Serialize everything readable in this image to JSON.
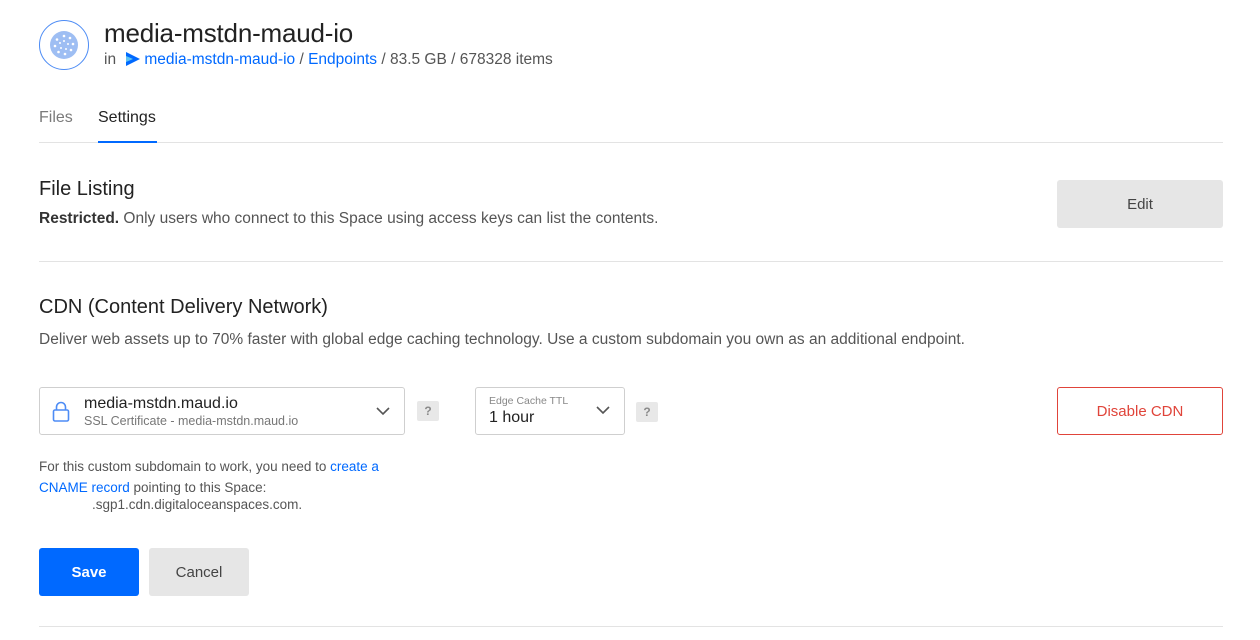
{
  "header": {
    "title": "media-mstdn-maud-io",
    "breadcrumb": {
      "prefix": "in",
      "space_link": "media-mstdn-maud-io",
      "sep1": "/",
      "endpoints_link": "Endpoints",
      "size": "/ 83.5 GB / 678328 items"
    }
  },
  "tabs": [
    {
      "label": "Files",
      "active": false
    },
    {
      "label": "Settings",
      "active": true
    }
  ],
  "file_listing": {
    "title": "File Listing",
    "status": "Restricted.",
    "description": " Only users who connect to this Space using access keys can list the contents.",
    "edit_label": "Edit"
  },
  "cdn": {
    "title": "CDN (Content Delivery Network)",
    "description": "Deliver web assets up to 70% faster with global edge caching technology. Use a custom subdomain you own as an additional endpoint.",
    "domain": {
      "name": "media-mstdn.maud.io",
      "certificate": "SSL Certificate - media-mstdn.maud.io"
    },
    "help_label": "?",
    "ttl": {
      "label": "Edge Cache TTL",
      "value": "1 hour"
    },
    "disable_label": "Disable CDN",
    "cname_note": {
      "text_before": "For this custom subdomain to work, you need to ",
      "link": "create a CNAME record",
      "text_after": " pointing to this Space:",
      "host": ".sgp1.cdn.digitaloceanspaces.com."
    },
    "save_label": "Save",
    "cancel_label": "Cancel"
  },
  "colors": {
    "accent": "#0069ff",
    "danger": "#e0443a"
  }
}
